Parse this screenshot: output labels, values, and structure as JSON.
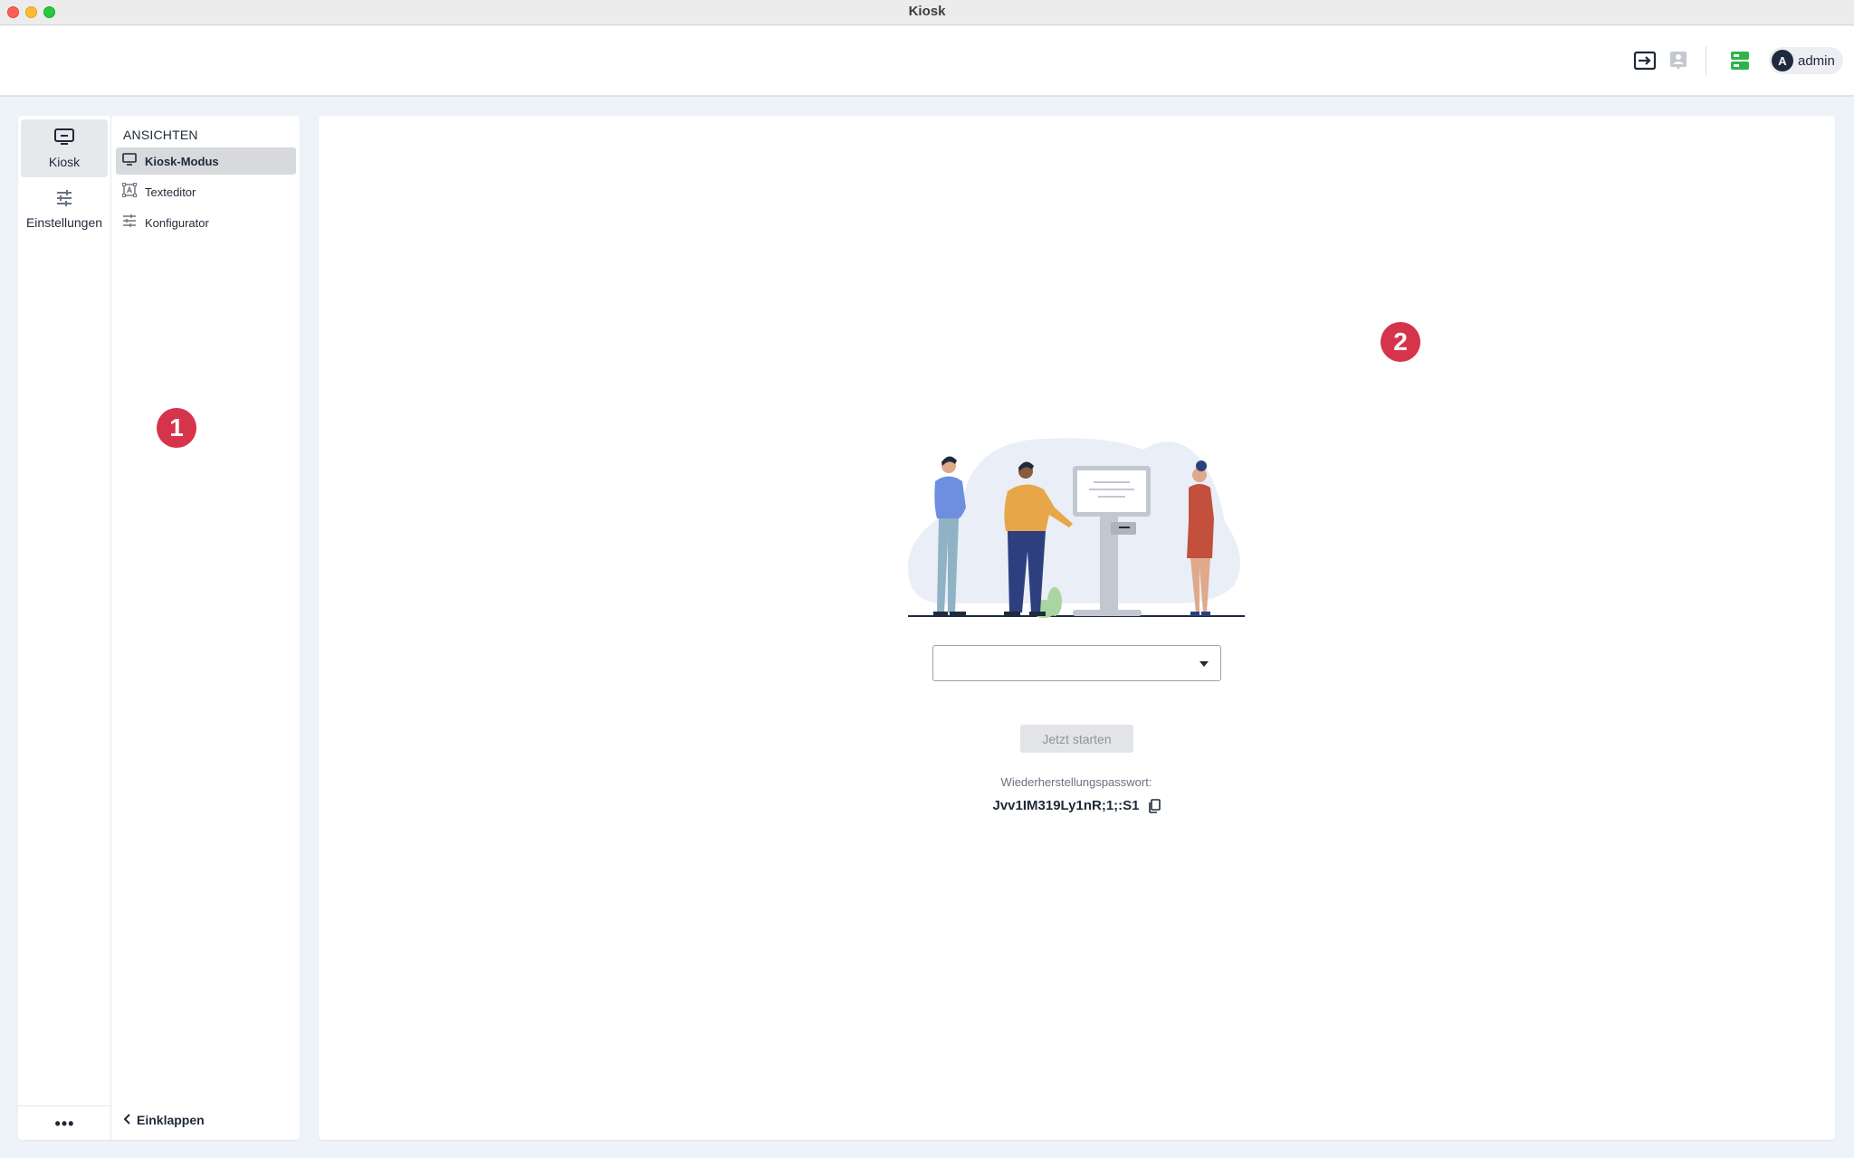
{
  "window": {
    "title": "Kiosk"
  },
  "header": {
    "icons": [
      "login-arrow-icon",
      "user-card-icon",
      "server-status-icon"
    ],
    "server_status_color": "#2fb34a",
    "user": {
      "initial": "A",
      "name": "admin"
    }
  },
  "sidebar": {
    "rail": [
      {
        "label": "Kiosk",
        "icon": "monitor-icon",
        "active": true
      },
      {
        "label": "Einstellungen",
        "icon": "sliders-icon",
        "active": false
      }
    ],
    "more_label": "•••",
    "heading": "ANSICHTEN",
    "items": [
      {
        "label": "Kiosk-Modus",
        "icon": "monitor-icon",
        "active": true
      },
      {
        "label": "Texteditor",
        "icon": "text-editor-icon",
        "active": false
      },
      {
        "label": "Konfigurator",
        "icon": "sliders-icon",
        "active": false
      }
    ],
    "collapse_label": "Einklappen"
  },
  "main": {
    "select": {
      "value": ""
    },
    "start_button": "Jetzt starten",
    "recovery_label": "Wiederherstellungspasswort:",
    "recovery_value": "Jvv1IM319Ly1nR;1;:S1"
  },
  "annotations": {
    "badge_1": "1",
    "badge_2": "2"
  },
  "colors": {
    "accent_badge": "#d5344a",
    "background": "#eef2f9"
  }
}
